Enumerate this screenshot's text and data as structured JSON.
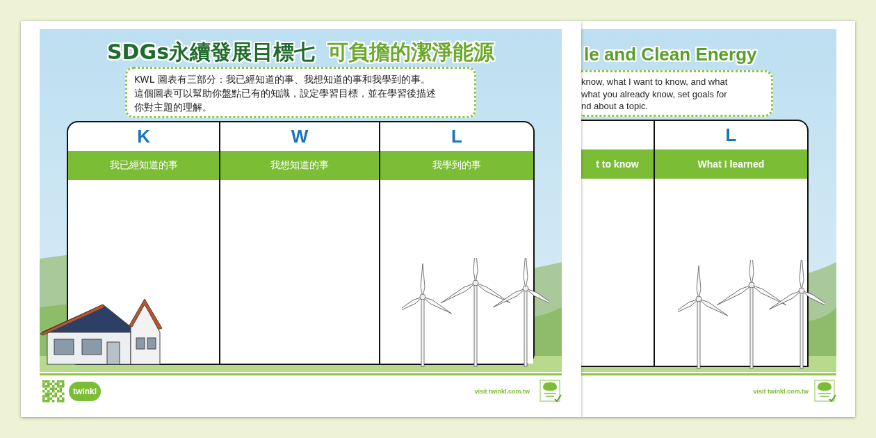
{
  "front_sheet": {
    "title_parts": [
      {
        "text": "SDGs永續發展目標七",
        "color": "#1f6b2c"
      },
      {
        "text": "可負擔的潔淨能源",
        "color": "#6aa92b"
      }
    ],
    "intro_lines": [
      "KWL 圖表有三部分：我已經知道的事、我想知道的事和我學到的事。",
      "這個圖表可以幫助你盤點已有的知識，設定學習目標，並在學習後描述",
      "你對主題的理解。"
    ],
    "columns": [
      {
        "letter": "K",
        "heading": "我已經知道的事"
      },
      {
        "letter": "W",
        "heading": "我想知道的事"
      },
      {
        "letter": "L",
        "heading": "我學到的事"
      }
    ],
    "footer": {
      "logo": "twinkl",
      "link": "visit twinkl.com.tw"
    }
  },
  "back_sheet": {
    "title_parts": [
      {
        "text": "le and Clean Energy",
        "color": "#5a9e2a"
      }
    ],
    "intro_lines": [
      "know, what I want to know, and what",
      "what you already know, set goals for",
      "nd about a topic."
    ],
    "columns": [
      {
        "heading": "t to know"
      },
      {
        "letter": "L",
        "heading": "What I learned"
      }
    ],
    "footer": {
      "link": "visit twinkl.com.tw"
    }
  }
}
